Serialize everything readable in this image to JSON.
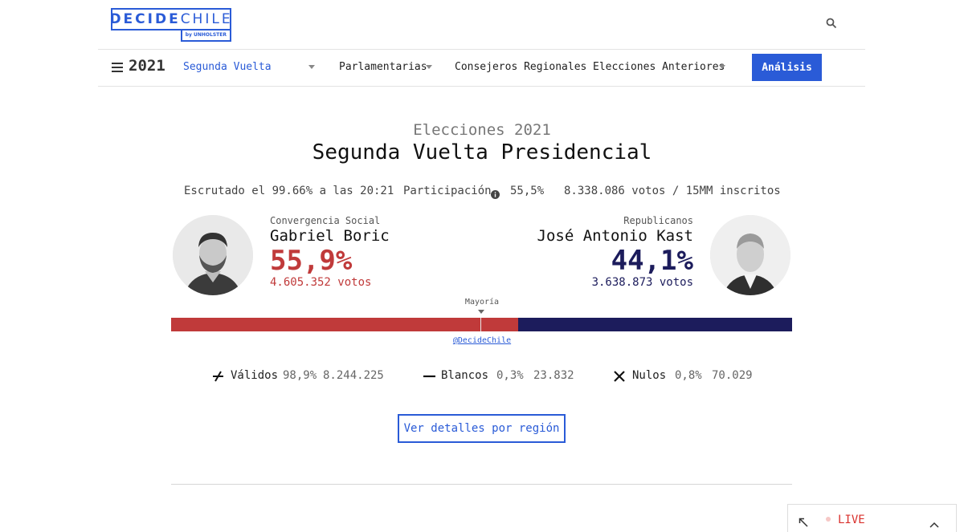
{
  "header": {
    "logo_main": "DECIDE",
    "logo_main_2": "CHILE",
    "logo_sub": "by UNHOLSTER",
    "search_icon": "search-icon"
  },
  "nav": {
    "year": "2021",
    "items": [
      {
        "label": "Segunda Vuelta",
        "active": true
      },
      {
        "label": "Parlamentarias"
      },
      {
        "label": "Consejeros Regionales"
      },
      {
        "label": "Elecciones Anteriores"
      }
    ],
    "analysis_label": "Análisis",
    "accent_color": "#2a5bd7"
  },
  "election": {
    "subtitle": "Elecciones 2021",
    "title": "Segunda Vuelta Presidencial",
    "scrutiny": "Escrutado el 99.66% a las 20:21",
    "participation_label": "Participación",
    "participation_value": "55,5%",
    "votes_summary": "8.338.086 votos / 15MM inscritos"
  },
  "candidates": [
    {
      "party": "Convergencia Social",
      "name": "Gabriel Boric",
      "pct": "55,9%",
      "votes": "4.605.352 votos",
      "color": "#c03a3a"
    },
    {
      "party": "Republicanos",
      "name": "José Antonio Kast",
      "pct": "44,1%",
      "votes": "3.638.873 votos",
      "color": "#1c1c5c"
    }
  ],
  "bar": {
    "majority_label": "Mayoría",
    "shares": [
      55.9,
      44.1
    ],
    "credit": "@DecideChile"
  },
  "summary": [
    {
      "label": "Válidos",
      "pct": "98,9%",
      "count": "8.244.225",
      "icon": "check-icon"
    },
    {
      "label": "Blancos",
      "pct": "0,3%",
      "count": "23.832",
      "icon": "dash-icon"
    },
    {
      "label": "Nulos",
      "pct": "0,8%",
      "count": "70.029",
      "icon": "x-icon"
    }
  ],
  "region_button": "Ver detalles por región",
  "live": {
    "label": "LIVE"
  }
}
